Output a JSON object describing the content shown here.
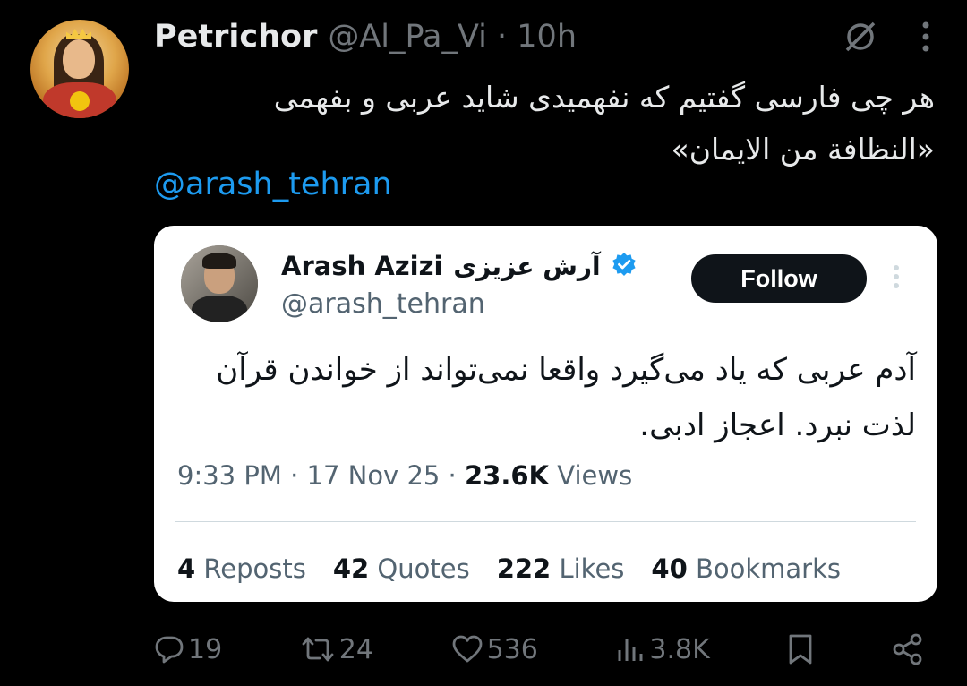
{
  "tweet": {
    "author_name": "Petrichor",
    "meta": "@Al_Pa_Vi · 10h",
    "text_lines": [
      "هر چی فارسی گفتیم که نفهمیدی شاید عربی و بفهمی",
      "«النظافة من الایمان»"
    ],
    "mention": "@arash_tehran"
  },
  "quote": {
    "name": "Arash Azizi",
    "name_fa": "آرش عزیزی",
    "handle": "@arash_tehran",
    "follow_label": "Follow",
    "text_lines": [
      "آدم عربی که یاد می‌گیرد واقعا نمی‌تواند از خواندن قرآن",
      "لذت نبرد. اعجاز ادبی."
    ],
    "time_prefix": "9:33 PM · 17 Nov 25 ·",
    "views_count": "23.6K",
    "views_label": "Views",
    "stats": [
      {
        "count": "4",
        "label": "Reposts"
      },
      {
        "count": "42",
        "label": "Quotes"
      },
      {
        "count": "222",
        "label": "Likes"
      },
      {
        "count": "40",
        "label": "Bookmarks"
      }
    ]
  },
  "actions": {
    "replies": "19",
    "reposts": "24",
    "likes": "536",
    "views": "3.8K"
  },
  "colors": {
    "background": "#000000",
    "link": "#1d9bf0",
    "verified": "#1d9bf0",
    "muted": "#71767b"
  },
  "icons": [
    "no-grok-icon",
    "more-icon",
    "verified-icon",
    "reply-icon",
    "repost-icon",
    "like-icon",
    "views-icon",
    "bookmark-icon",
    "share-icon"
  ]
}
